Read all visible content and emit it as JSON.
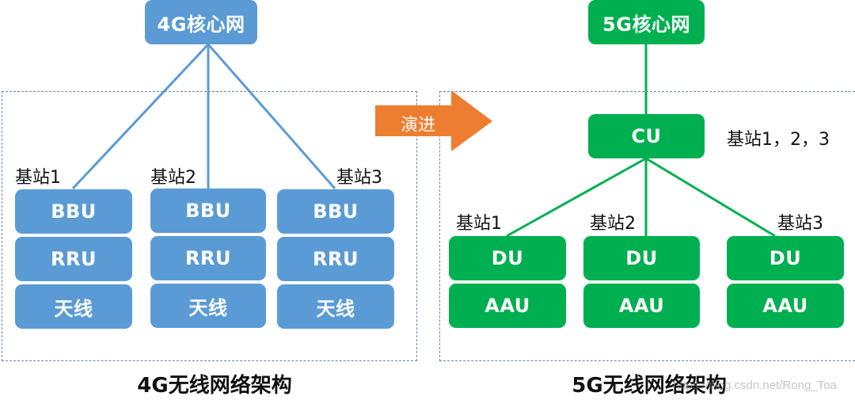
{
  "colors": {
    "lte_blue": "#5b9bd5",
    "nr_green": "#00b050",
    "arrow_orange": "#ed7d31",
    "dashed_border": "#6a86a6"
  },
  "lte": {
    "core_label": "4G核心网",
    "title": "4G无线网络架构",
    "stations": [
      {
        "label": "基站1",
        "units": [
          "BBU",
          "RRU",
          "天线"
        ]
      },
      {
        "label": "基站2",
        "units": [
          "BBU",
          "RRU",
          "天线"
        ]
      },
      {
        "label": "基站3",
        "units": [
          "BBU",
          "RRU",
          "天线"
        ]
      }
    ]
  },
  "evolution_arrow": {
    "label": "演进",
    "icon": "right-arrow-icon"
  },
  "nr": {
    "core_label": "5G核心网",
    "cu_label": "CU",
    "cu_annotation": "基站1，2，3",
    "title": "5G无线网络架构",
    "stations": [
      {
        "label": "基站1",
        "units": [
          "DU",
          "AAU"
        ]
      },
      {
        "label": "基站2",
        "units": [
          "DU",
          "AAU"
        ]
      },
      {
        "label": "基站3",
        "units": [
          "DU",
          "AAU"
        ]
      }
    ]
  },
  "watermark": "https://blog.csdn.net/Rong_Toa"
}
